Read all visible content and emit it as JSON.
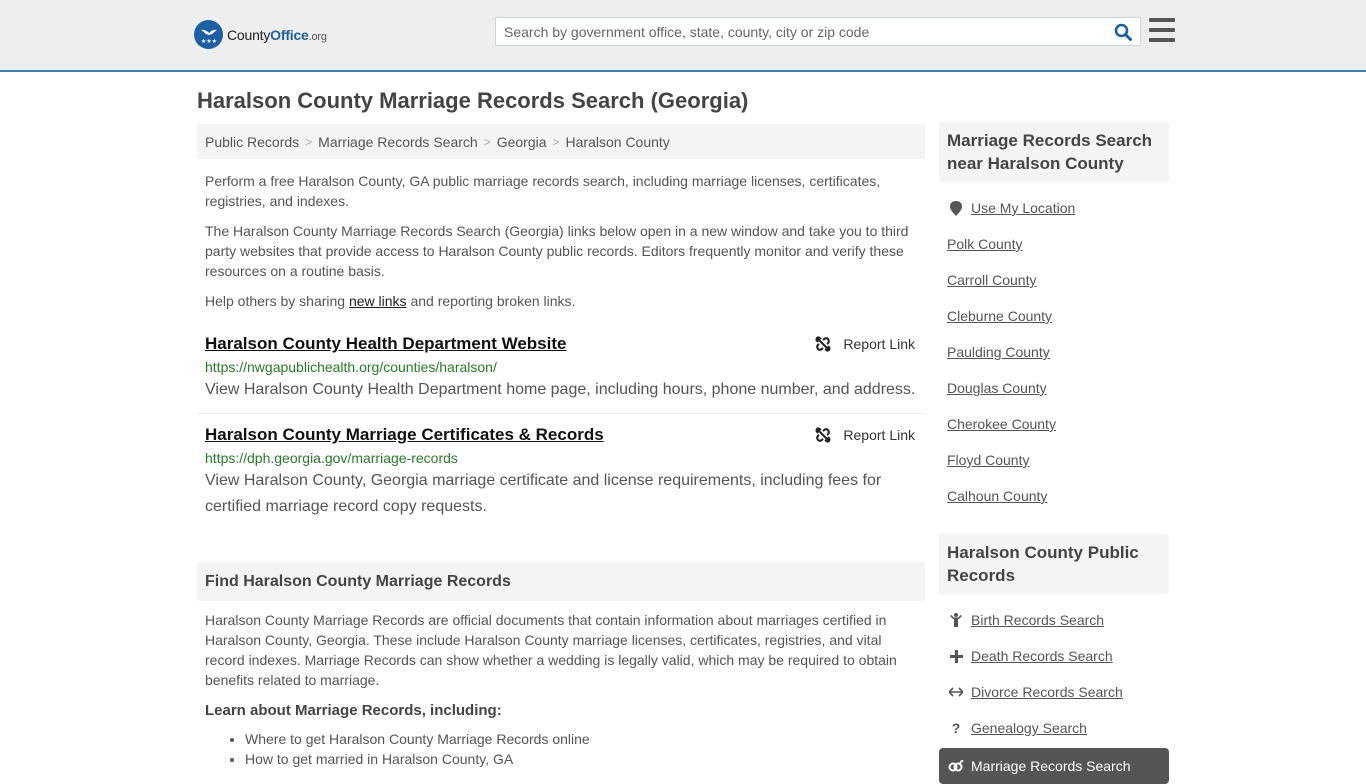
{
  "header": {
    "logo": {
      "name_part1": "County",
      "name_part2": "Office",
      "suffix": ".org"
    },
    "search": {
      "placeholder": "Search by government office, state, county, city or zip code",
      "value": ""
    },
    "accent_color": "#1d5fa3",
    "border_color": "#3a7fb5"
  },
  "page": {
    "title": "Haralson County Marriage Records Search (Georgia)"
  },
  "breadcrumb": [
    "Public Records",
    "Marriage Records Search",
    "Georgia",
    "Haralson County"
  ],
  "intro": {
    "p1": "Perform a free Haralson County, GA public marriage records search, including marriage licenses, certificates, registries, and indexes.",
    "p2": "The Haralson County Marriage Records Search (Georgia) links below open in a new window and take you to third party websites that provide access to Haralson County public records. Editors frequently monitor and verify these resources on a routine basis.",
    "p3_before": "Help others by sharing ",
    "p3_link": "new links",
    "p3_after": " and reporting broken links."
  },
  "links": [
    {
      "title": "Haralson County Health Department Website",
      "url": "https://nwgapublichealth.org/counties/haralson/",
      "description": "View Haralson County Health Department home page, including hours, phone number, and address.",
      "report_label": "Report Link"
    },
    {
      "title": "Haralson County Marriage Certificates & Records",
      "url": "https://dph.georgia.gov/marriage-records",
      "description": "View Haralson County, Georgia marriage certificate and license requirements, including fees for certified marriage record copy requests.",
      "report_label": "Report Link"
    }
  ],
  "find_section": {
    "heading": "Find Haralson County Marriage Records",
    "body": "Haralson County Marriage Records are official documents that contain information about marriages certified in Haralson County, Georgia. These include Haralson County marriage licenses, certificates, registries, and vital record indexes. Marriage Records can show whether a wedding is legally valid, which may be required to obtain benefits related to marriage.",
    "learn_heading": "Learn about Marriage Records, including:",
    "learn_items": [
      "Where to get Haralson County Marriage Records online",
      "How to get married in Haralson County, GA"
    ]
  },
  "sidebar": {
    "nearby": {
      "heading": "Marriage Records Search near Haralson County",
      "use_location": "Use My Location",
      "counties": [
        "Polk County",
        "Carroll County",
        "Cleburne County",
        "Paulding County",
        "Douglas County",
        "Cherokee County",
        "Floyd County",
        "Calhoun County"
      ]
    },
    "public_records": {
      "heading": "Haralson County Public Records",
      "items": [
        {
          "label": "Birth Records Search",
          "icon": "child-icon"
        },
        {
          "label": "Death Records Search",
          "icon": "plus-icon"
        },
        {
          "label": "Divorce Records Search",
          "icon": "arrows-horizontal-icon"
        },
        {
          "label": "Genealogy Search",
          "icon": "question-icon"
        },
        {
          "label": "Marriage Records Search",
          "icon": "marriage-icon",
          "active": true
        }
      ]
    }
  }
}
